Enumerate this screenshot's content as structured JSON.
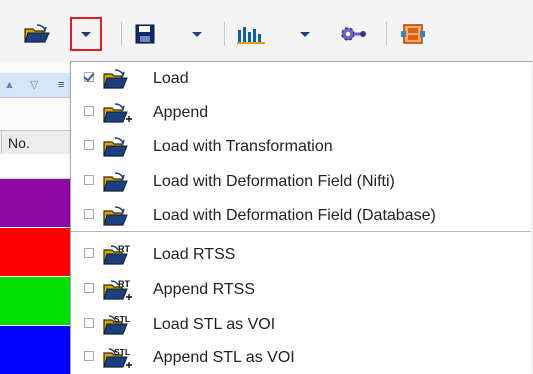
{
  "toolbar": {
    "buttons": [
      {
        "name": "open-folder-icon"
      },
      {
        "name": "dropdown-arrow-icon",
        "highlighted": true
      },
      {
        "name": "save-disk-icon"
      },
      {
        "name": "dropdown-arrow-icon"
      },
      {
        "name": "histogram-icon"
      },
      {
        "name": "dropdown-arrow-icon"
      },
      {
        "name": "settings-connector-icon"
      },
      {
        "name": "layout-window-icon"
      }
    ],
    "highlight_color": "#e02020"
  },
  "background_table": {
    "column_header": "No.",
    "row_colors": [
      "#ffffff",
      "#8e0aa4",
      "#8e0aa4",
      "#ff0000",
      "#ff0000",
      "#00e000",
      "#00e000",
      "#0000ff",
      "#0000ff"
    ]
  },
  "menu": {
    "items": [
      {
        "label": "Load",
        "checked": true,
        "icon": "open-folder-icon"
      },
      {
        "label": "Append",
        "checked": false,
        "icon": "open-folder-plus-icon"
      },
      {
        "label": "Load with Transformation",
        "checked": false,
        "icon": "open-folder-icon"
      },
      {
        "label": "Load with Deformation Field (Nifti)",
        "checked": false,
        "icon": "open-folder-icon"
      },
      {
        "label": "Load with Deformation Field (Database)",
        "checked": false,
        "icon": "open-folder-icon"
      },
      {
        "label": "Load RTSS",
        "checked": false,
        "icon": "open-folder-rt-icon",
        "badge": "RT"
      },
      {
        "label": "Append RTSS",
        "checked": false,
        "icon": "open-folder-rt-plus-icon",
        "badge": "RT"
      },
      {
        "label": "Load STL as VOI",
        "checked": false,
        "icon": "open-folder-stl-icon",
        "badge": "STL"
      },
      {
        "label": "Append STL as VOI",
        "checked": false,
        "icon": "open-folder-stl-plus-icon",
        "badge": "STL"
      }
    ]
  }
}
